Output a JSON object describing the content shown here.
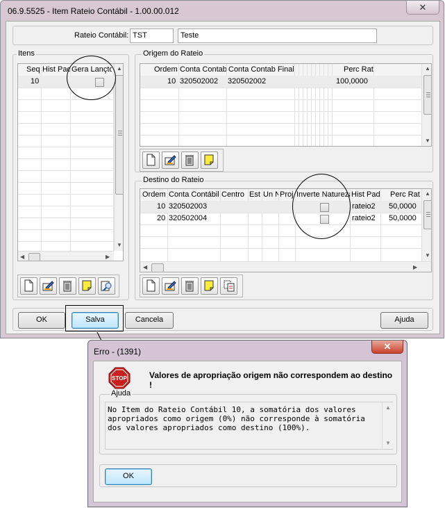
{
  "main_window": {
    "title": "06.9.5525 - Item Rateio Contábil - 1.00.00.012",
    "close_glyph": "✕",
    "rateio_label": "Rateio Contábil:",
    "rateio_code": "TST",
    "rateio_desc": "Teste"
  },
  "itens": {
    "label": "Itens",
    "columns": [
      "Seq",
      "Hist Pad",
      "Gera Lançto"
    ],
    "rows": [
      {
        "seq": "10",
        "hist_pad": "",
        "gera_lancto": false
      }
    ]
  },
  "origem": {
    "label": "Origem do Rateio",
    "columns": [
      "Ordem",
      "Conta Contab",
      "Conta Contab Final",
      "Perc Rat"
    ],
    "rows": [
      {
        "ordem": "10",
        "conta": "320502002",
        "conta_final": "320502002",
        "perc": "100,0000"
      }
    ]
  },
  "destino": {
    "label": "Destino do Rateio",
    "columns": [
      "Ordem",
      "Conta Contábil",
      "Centro",
      "Est",
      "Un N",
      "Proj",
      "Inverte Natureza",
      "Hist Pad",
      "Perc Rat"
    ],
    "rows": [
      {
        "ordem": "10",
        "conta": "320502003",
        "inverte": false,
        "hist": "rateio2",
        "perc": "50,0000"
      },
      {
        "ordem": "20",
        "conta": "320502004",
        "inverte": false,
        "hist": "rateio2",
        "perc": "50,0000"
      }
    ]
  },
  "toolbar_icons": [
    "new-icon",
    "edit-icon",
    "delete-icon",
    "note-icon",
    "search-icon",
    "copy-icon"
  ],
  "buttons": {
    "ok": "OK",
    "salva": "Salva",
    "cancela": "Cancela",
    "ajuda": "Ajuda"
  },
  "error_dialog": {
    "title": "Erro - (1391)",
    "close_glyph": "✕",
    "stop_text": "STOP",
    "message": "Valores de apropriação origem não correspondem ao destino !",
    "help_label": "Ajuda",
    "help_text": "No Item do Rateio Contábil 10, a somatória dos valores apropriados como origem (0%) não corresponde à somatória dos valores apropriados como destino (100%).",
    "ok_label": "OK"
  },
  "colors": {
    "title_bar": "#d8c8d4",
    "stop_red": "#c8201e",
    "focus_blue": "#4a90d9"
  }
}
